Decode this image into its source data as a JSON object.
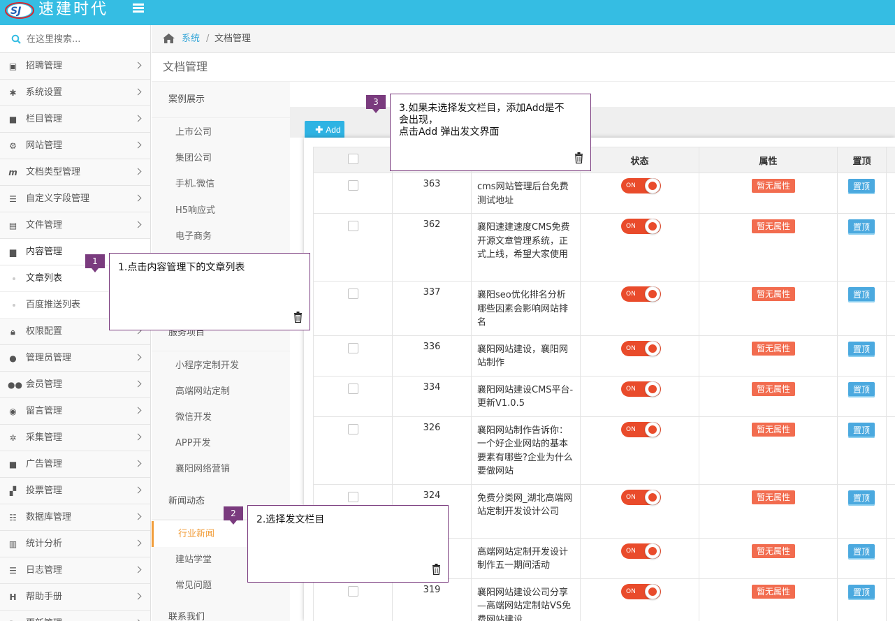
{
  "header": {
    "brand": "速建时代",
    "logo_text": "SJ"
  },
  "search": {
    "placeholder": "在这里搜索..."
  },
  "sidebar": {
    "items": [
      {
        "label": "招聘管理",
        "icon": "money-icon"
      },
      {
        "label": "系统设置",
        "icon": "gear-icon"
      },
      {
        "label": "栏目管理",
        "icon": "folder-icon"
      },
      {
        "label": "网站管理",
        "icon": "cogs-icon"
      },
      {
        "label": "文档类型管理",
        "icon": "m-icon"
      },
      {
        "label": "自定义字段管理",
        "icon": "list-icon"
      },
      {
        "label": "文件管理",
        "icon": "save-icon"
      },
      {
        "label": "内容管理",
        "icon": "file-icon"
      }
    ],
    "sub_items": [
      {
        "label": "文章列表"
      },
      {
        "label": "百度推送列表"
      }
    ],
    "items2": [
      {
        "label": "权限配置",
        "icon": "lock-icon"
      },
      {
        "label": "管理员管理",
        "icon": "user-icon"
      },
      {
        "label": "会员管理",
        "icon": "users-icon"
      },
      {
        "label": "留言管理",
        "icon": "comments-icon"
      },
      {
        "label": "采集管理",
        "icon": "bug-icon"
      },
      {
        "label": "广告管理",
        "icon": "video-icon"
      },
      {
        "label": "投票管理",
        "icon": "sitemap-icon"
      },
      {
        "label": "数据库管理",
        "icon": "th-list-icon"
      },
      {
        "label": "统计分析",
        "icon": "bar-chart-icon"
      },
      {
        "label": "日志管理",
        "icon": "list-alt-icon"
      },
      {
        "label": "帮助手册",
        "icon": "h-square-icon"
      },
      {
        "label": "更新管理",
        "icon": "refresh-icon"
      }
    ]
  },
  "breadcrumb": {
    "root": "系统",
    "sep": "/",
    "current": "文档管理"
  },
  "page": {
    "title": "文档管理"
  },
  "categories": {
    "group1": "案例展示",
    "group1_items": [
      "上市公司",
      "集团公司",
      "手机.微信",
      "H5响应式",
      "电子商务"
    ],
    "group2": "服务项目",
    "group2_items": [
      "小程序定制开发",
      "高端网站定制",
      "微信开发",
      "APP开发",
      "襄阳网络营销"
    ],
    "group3": "新闻动态",
    "group3_items": [
      "行业新闻",
      "建站学堂",
      "常见问题"
    ],
    "group4": "联系我们"
  },
  "toolbar": {
    "add_label": "Add"
  },
  "table": {
    "headers": {
      "status": "状态",
      "attr": "属性",
      "top": "置顶"
    },
    "rows": [
      {
        "id": "363",
        "title": "cms网站管理后台免费测试地址",
        "status": "ON",
        "attr": "暂无属性",
        "top": "置顶"
      },
      {
        "id": "362",
        "title": "襄阳速建速度CMS免费开源文章管理系统，正式上线，希望大家使用",
        "status": "ON",
        "attr": "暂无属性",
        "top": "置顶"
      },
      {
        "id": "337",
        "title": "襄阳seo优化排名分析哪些因素会影响网站排名",
        "status": "ON",
        "attr": "暂无属性",
        "top": "置顶"
      },
      {
        "id": "336",
        "title": "襄阳网站建设，襄阳网站制作",
        "status": "ON",
        "attr": "暂无属性",
        "top": "置顶"
      },
      {
        "id": "334",
        "title": "襄阳网站建设CMS平台-更新V1.0.5",
        "status": "ON",
        "attr": "暂无属性",
        "top": "置顶"
      },
      {
        "id": "326",
        "title": "襄阳网站制作告诉你：一个好企业网站的基本要素有哪些?企业为什么要做网站",
        "status": "ON",
        "attr": "暂无属性",
        "top": "置顶"
      },
      {
        "id": "324",
        "title": "免费分类网_湖北高端网站定制开发设计公司",
        "status": "ON",
        "attr": "暂无属性",
        "top": "置顶"
      },
      {
        "id": "",
        "title": "高端网站定制开发设计制作五一期间活动",
        "status": "ON",
        "attr": "暂无属性",
        "top": "置顶"
      },
      {
        "id": "319",
        "title": "襄阳网站建设公司分享—高端网站定制站VS免费网站建设",
        "status": "ON",
        "attr": "暂无属性",
        "top": "置顶"
      }
    ]
  },
  "callouts": [
    {
      "num": "1",
      "text": "1.点击内容管理下的文章列表"
    },
    {
      "num": "2",
      "text": "2.选择发文栏目"
    },
    {
      "num": "3",
      "text": "3.如果未选择发文栏目，添加Add是不会出现，\n点击Add 弹出发文界面",
      "line1": "3.如果未选择发文栏目，添加Add是不",
      "line2": "会出现，",
      "line3": "点击Add 弹出发文界面"
    }
  ],
  "colors": {
    "topbar": "#35bde3",
    "accent": "#f19d3a",
    "switch": "#e94b2b",
    "badge": "#f26c4f",
    "button": "#4ba9df",
    "callout": "#7a3b7e"
  }
}
